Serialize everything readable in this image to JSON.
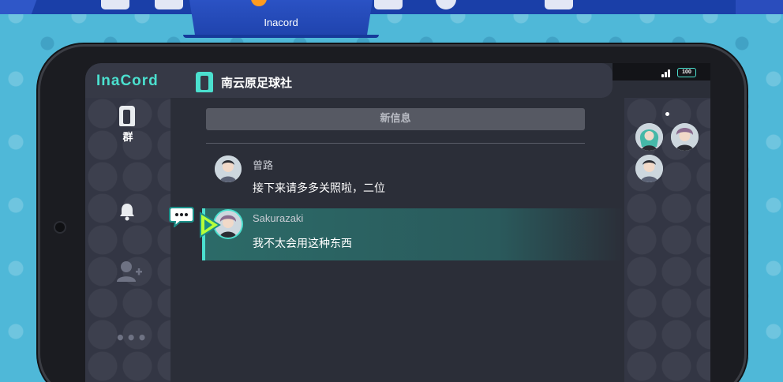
{
  "top_tabs": {
    "active_label": "Inacord",
    "icons": [
      "house-icon",
      "box-icon",
      "shirt-icon",
      "inacord-icon",
      "screen-icon",
      "team-icon",
      "globe-icon",
      "card-icon"
    ]
  },
  "app": {
    "brand": "InaCord",
    "chat_title": "南云原足球社",
    "battery": "100"
  },
  "left_nav": {
    "group_label": "群",
    "items": [
      "group-icon",
      "bell-icon",
      "add-friend-icon",
      "more-icon"
    ]
  },
  "feed": {
    "new_messages_label": "新信息",
    "messages": [
      {
        "name": "曾路",
        "text": "接下来请多多关照啦，二位"
      },
      {
        "name": "Sakurazaki",
        "text": "我不太会用这种东西"
      }
    ]
  },
  "members": {
    "count": 3
  },
  "colors": {
    "accent": "#4be0cf",
    "background_pattern": "#4fb8d8",
    "tab_bar": "#1a3fa8",
    "screen_bg": "#2b2e38",
    "panel_bg": "#333644"
  }
}
